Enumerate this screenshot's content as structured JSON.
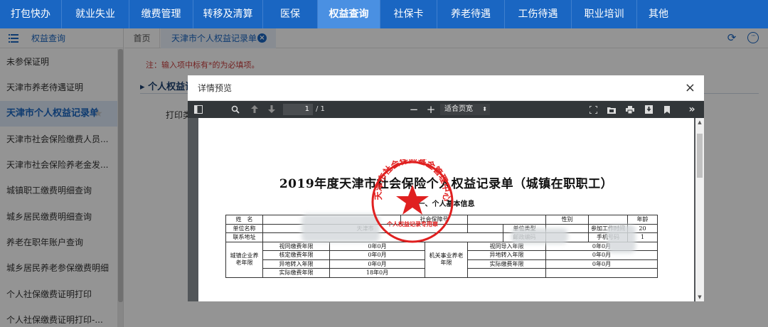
{
  "topnav": {
    "items": [
      {
        "label": "打包快办"
      },
      {
        "label": "就业失业"
      },
      {
        "label": "缴费管理"
      },
      {
        "label": "转移及清算"
      },
      {
        "label": "医保"
      },
      {
        "label": "权益查询",
        "active": true
      },
      {
        "label": "社保卡"
      },
      {
        "label": "养老待遇"
      },
      {
        "label": "工伤待遇"
      },
      {
        "label": "职业培训"
      },
      {
        "label": "其他"
      }
    ]
  },
  "sidebar": {
    "title": "权益查询",
    "items": [
      {
        "label": "未参保证明"
      },
      {
        "label": "天津市养老待遇证明"
      },
      {
        "label": "天津市个人权益记录单",
        "active": true
      },
      {
        "label": "天津市社会保险缴费人员..."
      },
      {
        "label": "天津市社会保险养老金发..."
      },
      {
        "label": "城镇职工缴费明细查询"
      },
      {
        "label": "城乡居民缴费明细查询"
      },
      {
        "label": "养老在职年账户查询"
      },
      {
        "label": "城乡居民养老参保缴费明细"
      },
      {
        "label": "个人社保缴费证明打印"
      },
      {
        "label": "个人社保缴费证明打印-..."
      }
    ]
  },
  "tabs": {
    "home": "首页",
    "current": "天津市个人权益记录单"
  },
  "content": {
    "note": "注：输入项中标有*的为必填项。",
    "section_title": "个人权益记",
    "print_label": "打印类"
  },
  "modal": {
    "title": "详情预览",
    "close": "×"
  },
  "pdf": {
    "page_current": "1",
    "page_total": "/ 1",
    "zoom": "适合页宽",
    "zoom_out": "−",
    "zoom_in": "+"
  },
  "document": {
    "title": "2019年度天津市社会保险个人权益记录单（城镇在职职工）",
    "subtitle": "一、个人基本信息",
    "stamp_text": "天津市社会保险基金管理中心",
    "stamp_sub": "个人权益记录专用章",
    "rows": {
      "name_label": "姓　名",
      "ss_no_label": "社会保障号",
      "gender_label": "性别",
      "age_label": "年龄",
      "unit_label": "单位名称",
      "unit_value": "天津市",
      "unit_type_label": "单位类型",
      "work_start_label": "参加工作时间",
      "work_start_value": "20",
      "address_label": "联系地址",
      "postcode_label": "邮政编码",
      "phone_label": "手机号码",
      "phone_value": "1",
      "urban_group": "城镇企业养老年限",
      "inst_group": "机关事业养老年限",
      "deemed_label": "视同缴费年限",
      "deemed_value": "0年0月",
      "verified_label": "核定缴费年限",
      "verified_value": "0年0月",
      "transfer_in_label": "异地转入年限",
      "transfer_in_value": "0年0月",
      "actual_label": "实际缴费年限",
      "actual_value": "18年0月",
      "r_deemed_label": "视同导入年限",
      "r_deemed_value": "0年0月",
      "r_transfer_label": "异地转入年限",
      "r_transfer_value": "0年0月",
      "r_actual_label": "实际缴费年限",
      "r_actual_value": "0年0月"
    }
  },
  "colors": {
    "nav_bg": "#1a66c2",
    "nav_active": "#4a90e2",
    "stamp_red": "#e02020"
  }
}
